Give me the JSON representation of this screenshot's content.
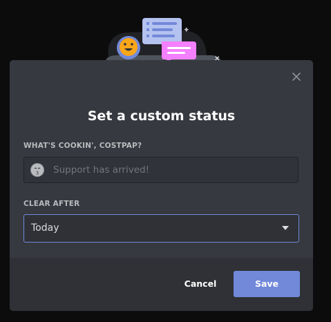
{
  "dialog": {
    "title": "Set a custom status",
    "close_icon": "close-icon"
  },
  "status": {
    "label": "WHAT'S COOKIN', COSTPAP?",
    "placeholder": "Support has arrived!",
    "value": "",
    "emoji_icon": "emoji-icon"
  },
  "clear_after": {
    "label": "CLEAR AFTER",
    "selected": "Today",
    "caret_icon": "chevron-down-icon"
  },
  "footer": {
    "cancel_label": "Cancel",
    "save_label": "Save"
  },
  "colors": {
    "backdrop": "#0c0c0d",
    "modal": "#36393f",
    "footer": "#2f3136",
    "accent": "#7289da",
    "text_primary": "#ffffff",
    "text_muted": "#b9bbbe",
    "placeholder": "#72767d"
  }
}
